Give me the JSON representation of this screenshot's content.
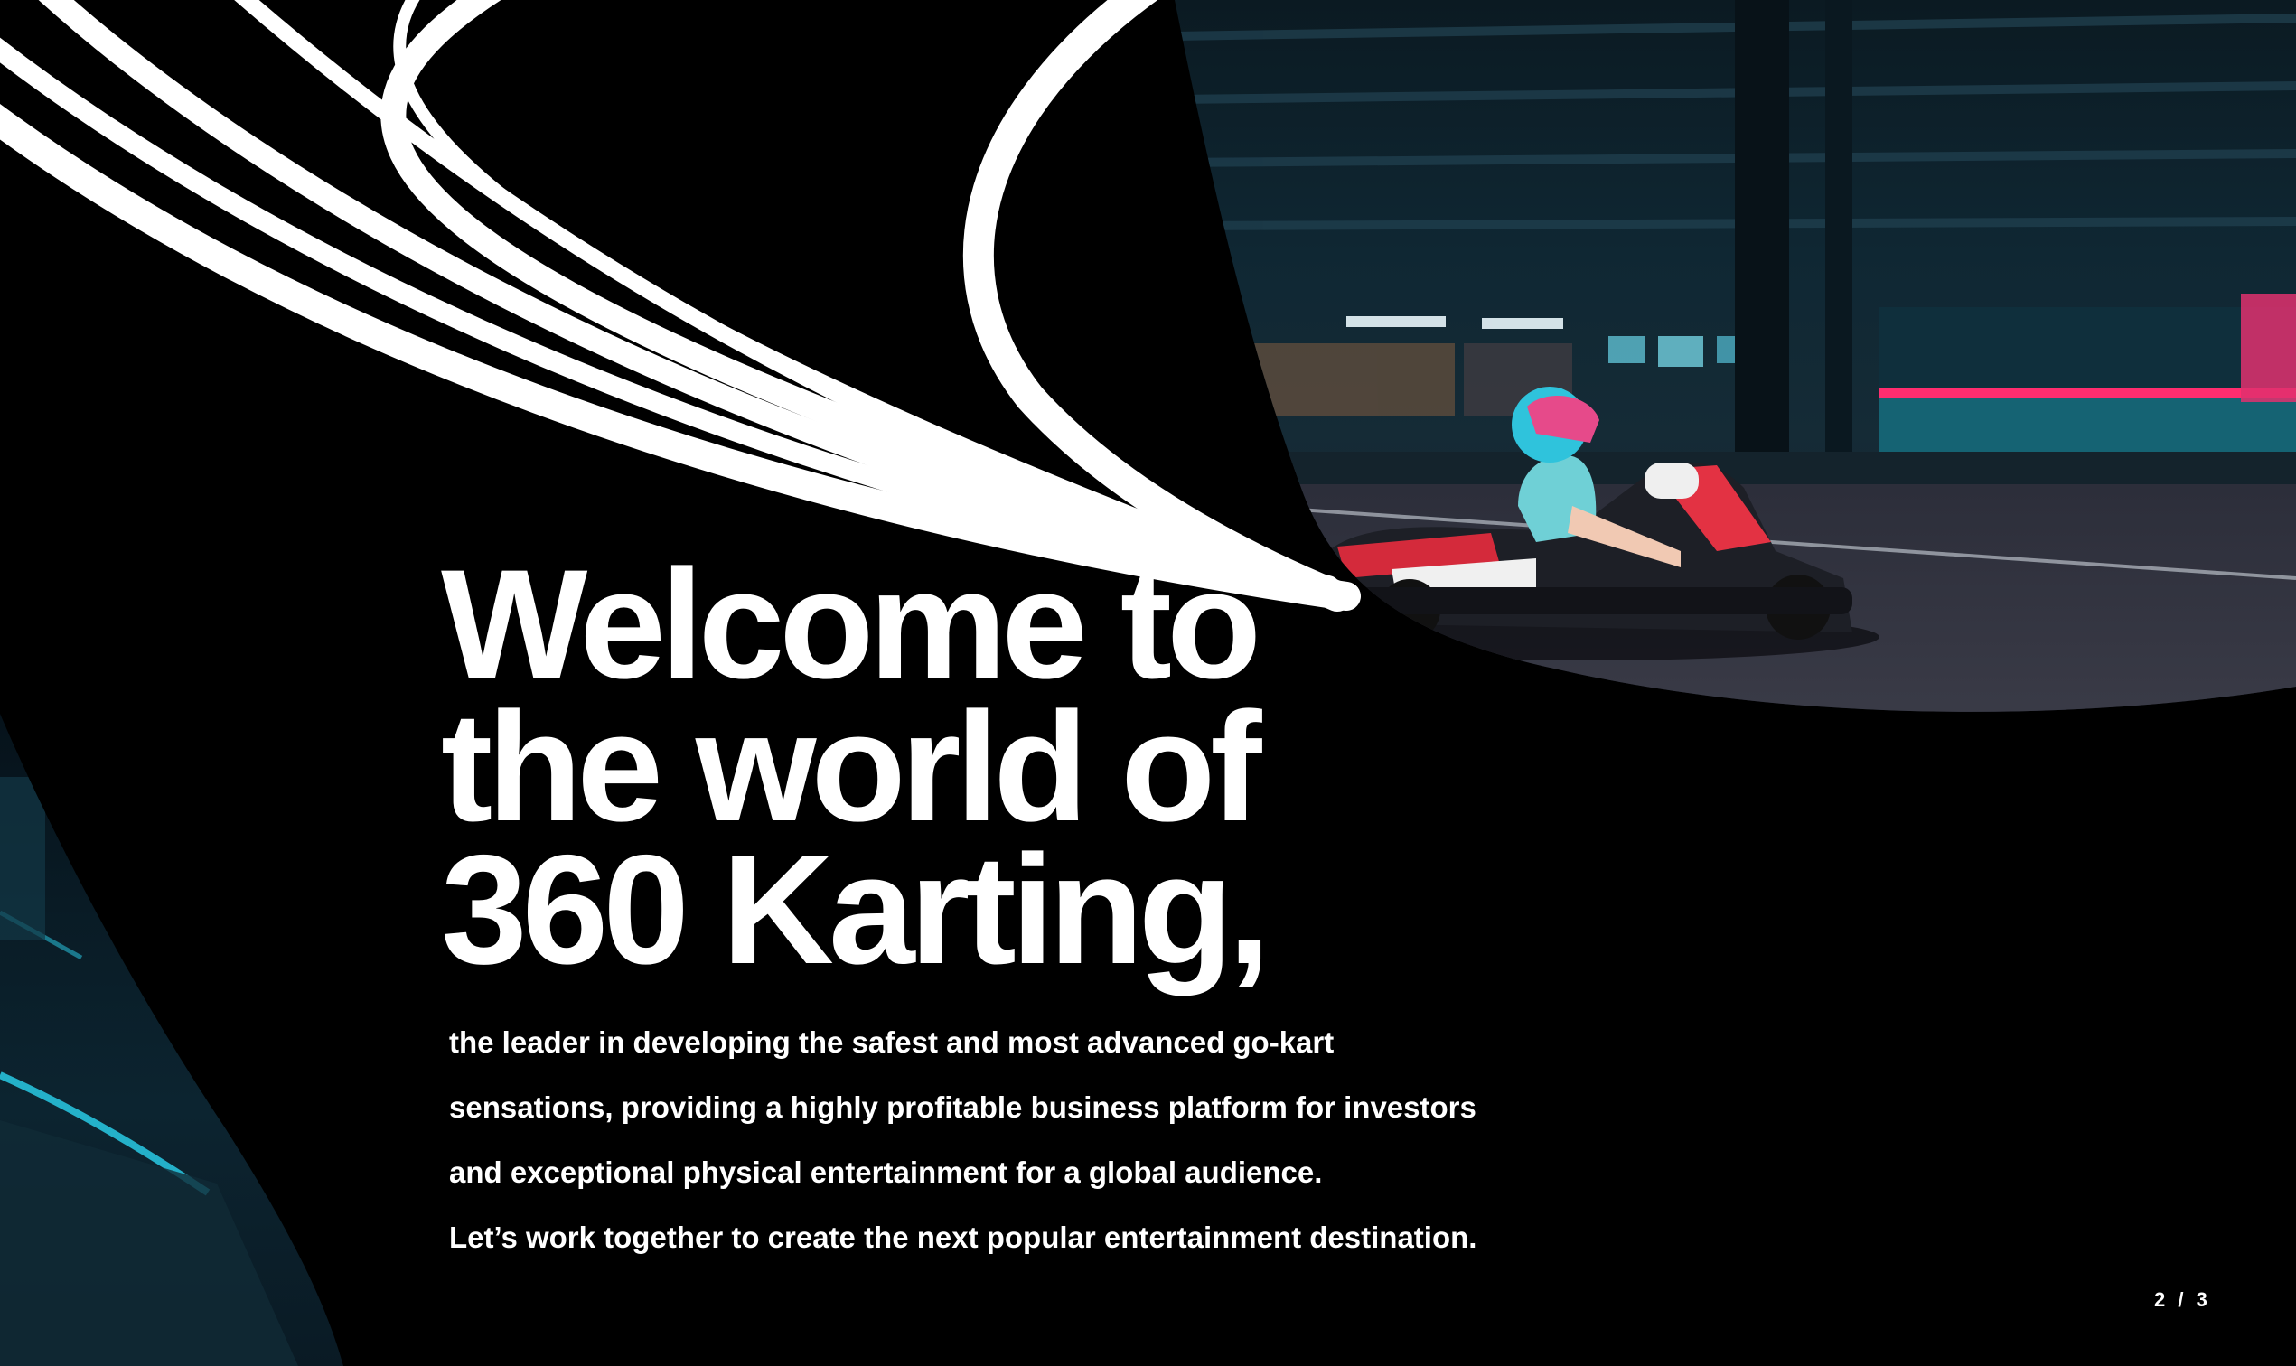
{
  "headline": {
    "line1": "Welcome to",
    "line2": "the world of",
    "line3": "360 Karting,"
  },
  "body": {
    "line1": "the leader in developing the safest and most advanced go-kart",
    "line2": "sensations, providing a highly profitable business platform for investors",
    "line3": "and exceptional physical entertainment for a global audience.",
    "line4": "Let’s work together to create the next popular entertainment destination."
  },
  "page_number": "2 / 3",
  "colors": {
    "background": "#000000",
    "text": "#ffffff",
    "accent_cyan": "#2bd4f0",
    "accent_pink": "#ff2d6f"
  }
}
